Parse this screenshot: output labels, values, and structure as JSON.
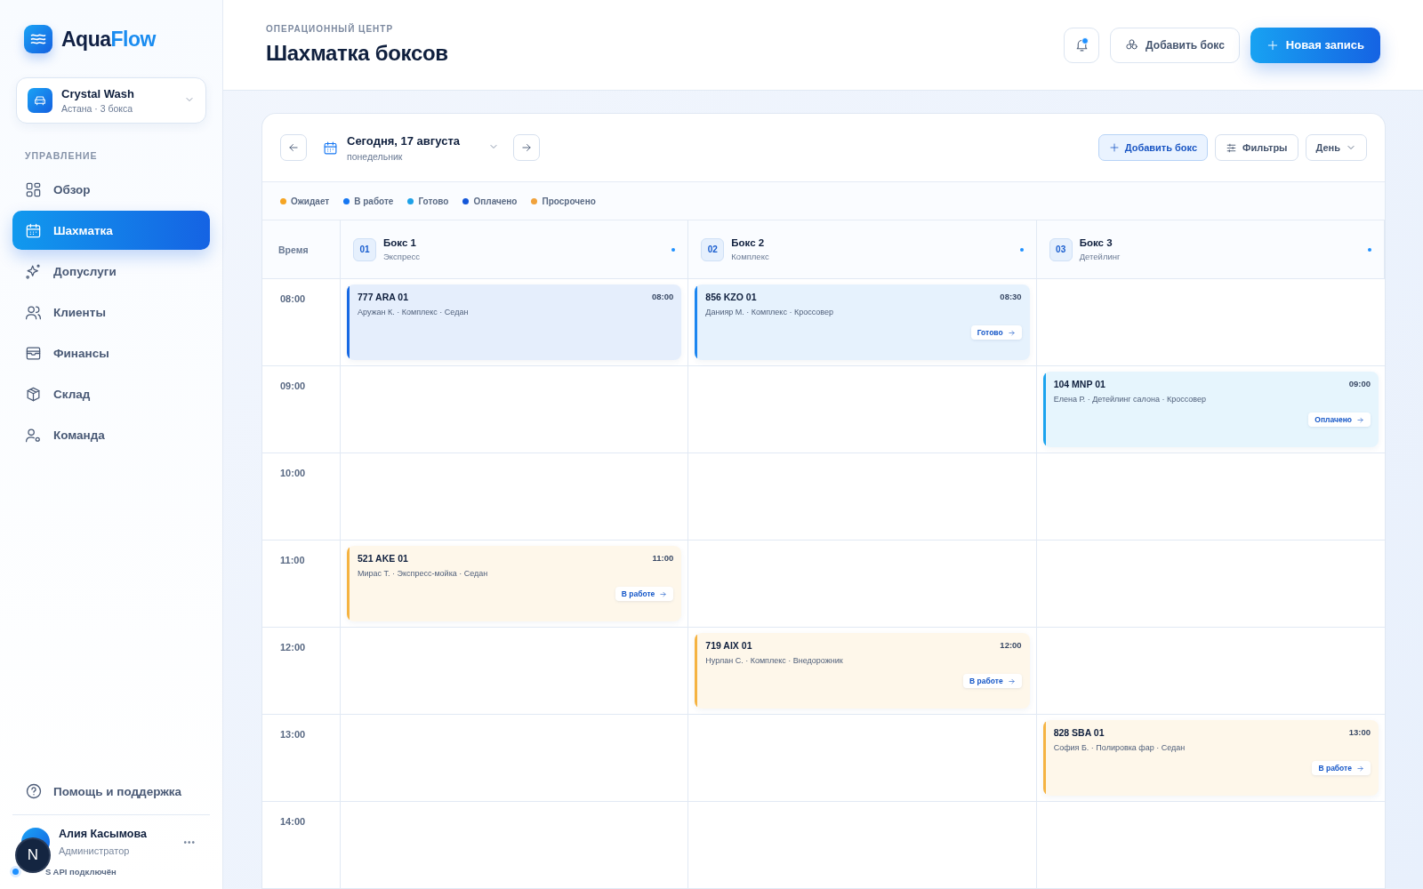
{
  "sidebar": {
    "logo": {
      "part1": "Aqua",
      "part2": "Flow"
    },
    "location": {
      "name": "Crystal Wash",
      "sub": "Астана · 3 бокса"
    },
    "section_label": "УПРАВЛЕНИЕ",
    "items": [
      {
        "label": "Обзор",
        "selected": false
      },
      {
        "label": "Шахматка",
        "selected": true
      },
      {
        "label": "Допуслуги",
        "selected": false
      },
      {
        "label": "Клиенты",
        "selected": false
      },
      {
        "label": "Финансы",
        "selected": false
      },
      {
        "label": "Склад",
        "selected": false
      },
      {
        "label": "Команда",
        "selected": false
      }
    ],
    "help": "Помощь и поддержка",
    "user": {
      "name": "Алия Касымова",
      "role": "Администратор",
      "menu": "•••"
    },
    "status": "S API подключён",
    "dev_badge": "N"
  },
  "header": {
    "eyebrow": "ОПЕРАЦИОННЫЙ ЦЕНТР",
    "title": "Шахматка боксов",
    "add_box": "Добавить бокс",
    "new_record": "Новая запись"
  },
  "toolbar": {
    "date": "Сегодня, 17 августа",
    "weekday": "понедельник",
    "add_box": "Добавить бокс",
    "filters": "Фильтры",
    "view": "День"
  },
  "legend": [
    {
      "label": "Ожидает",
      "color": "#f5a524"
    },
    {
      "label": "В работе",
      "color": "#1677f2"
    },
    {
      "label": "Готово",
      "color": "#1da1e8"
    },
    {
      "label": "Оплачено",
      "color": "#1457d9"
    },
    {
      "label": "Просрочено",
      "color": "#f0a23c"
    }
  ],
  "grid": {
    "time_header": "Время",
    "boxes": [
      {
        "number": "01",
        "name": "Бокс 1",
        "type": "Экспресс"
      },
      {
        "number": "02",
        "name": "Бокс 2",
        "type": "Комплекс"
      },
      {
        "number": "03",
        "name": "Бокс 3",
        "type": "Детейлинг"
      }
    ],
    "rows": [
      {
        "time": "08:00",
        "cells": [
          {
            "plate": "777 ARA 01",
            "time": "08:00",
            "details": "Аружан К. · Комплекс · Седан",
            "color": "#1668e3"
          },
          {
            "plate": "856 KZO 01",
            "time": "08:30",
            "details": "Данияр М. · Комплекс · Кроссовер",
            "status": "Готово",
            "color": "#1c86f0"
          },
          null
        ]
      },
      {
        "time": "09:00",
        "cells": [
          null,
          null,
          {
            "plate": "104 MNP 01",
            "time": "09:00",
            "details": "Елена Р. · Детейлинг салона · Кроссовер",
            "status": "Оплачено",
            "color": "#1aa3ee"
          }
        ]
      },
      {
        "time": "10:00",
        "cells": [
          null,
          null,
          null
        ]
      },
      {
        "time": "11:00",
        "cells": [
          {
            "plate": "521 AKE 01",
            "time": "11:00",
            "details": "Мирас Т. · Экспресс-мойка · Седан",
            "status": "В работе",
            "color": "#f5b342"
          },
          null,
          null
        ]
      },
      {
        "time": "12:00",
        "cells": [
          null,
          {
            "plate": "719 AIX 01",
            "time": "12:00",
            "details": "Нурлан С. · Комплекс · Внедорожник",
            "status": "В работе",
            "color": "#f5b342"
          },
          null
        ]
      },
      {
        "time": "13:00",
        "cells": [
          null,
          null,
          {
            "plate": "828 SBA 01",
            "time": "13:00",
            "details": "София Б. · Полировка фар · Седан",
            "status": "В работе",
            "color": "#f5b342"
          }
        ]
      },
      {
        "time": "14:00",
        "cells": [
          null,
          null,
          null
        ]
      }
    ]
  }
}
